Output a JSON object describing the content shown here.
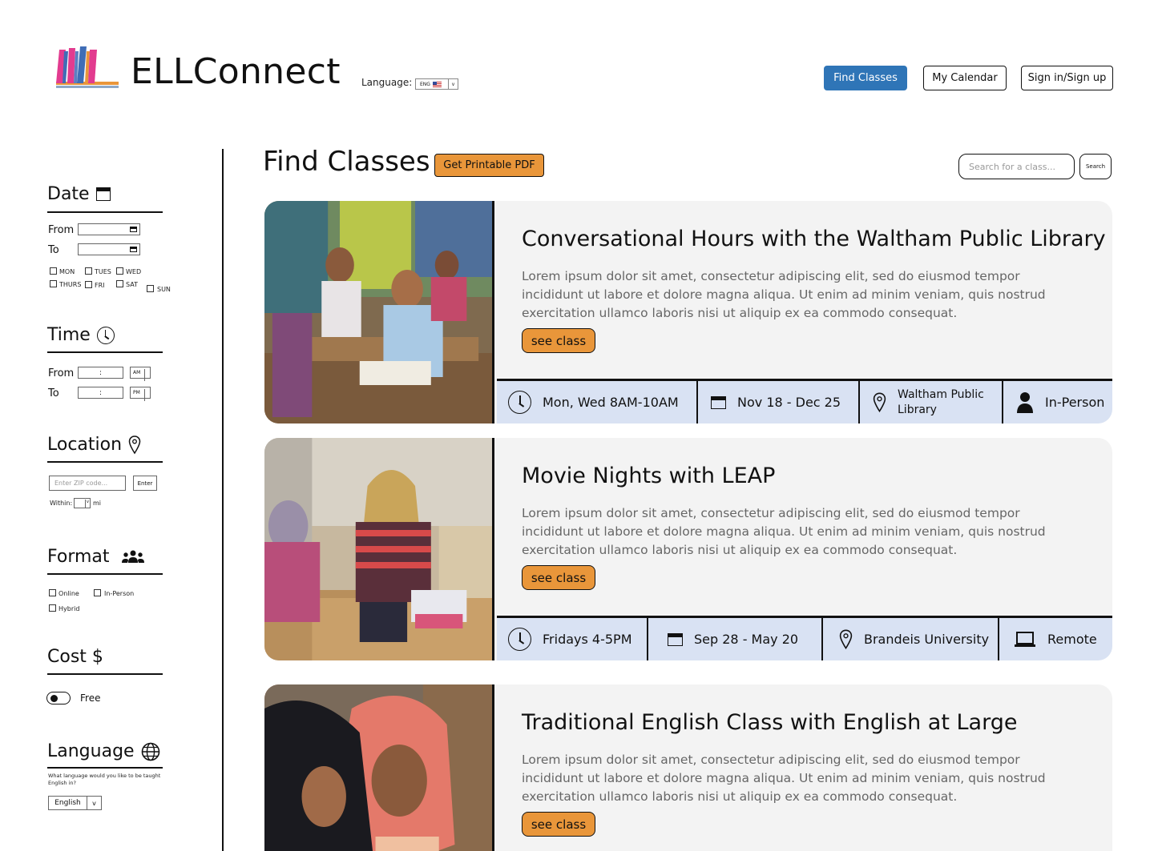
{
  "app": {
    "name": "ELLConnect",
    "language_label": "Language:",
    "language_code": "ENG"
  },
  "nav": {
    "find_classes": "Find Classes",
    "my_calendar": "My Calendar",
    "sign_in": "Sign in/Sign up"
  },
  "filters": {
    "date": {
      "title": "Date",
      "from": "From",
      "to": "To",
      "days": [
        "MON",
        "TUES",
        "WED",
        "THURS",
        "FRI",
        "SAT",
        "SUN"
      ]
    },
    "time": {
      "title": "Time",
      "from": "From",
      "to": "To",
      "placeholder": ":",
      "am": "AM",
      "pm": "PM"
    },
    "location": {
      "title": "Location",
      "zip_placeholder": "Enter ZIP code...",
      "enter": "Enter",
      "within": "Within:",
      "unit": "mi"
    },
    "format": {
      "title": "Format",
      "online": "Online",
      "in_person": "In-Person",
      "hybrid": "Hybrid"
    },
    "cost": {
      "title": "Cost $",
      "free": "Free"
    },
    "language": {
      "title": "Language",
      "question": "What language would you like to be taught English in?",
      "selected": "English",
      "arrow": "v"
    }
  },
  "main": {
    "title": "Find Classes",
    "pdf_button": "Get Printable PDF",
    "search_placeholder": "Search for a class...",
    "search_button": "Search",
    "see_class": "see class"
  },
  "classes": [
    {
      "title": "Conversational Hours with the Waltham Public Library",
      "description": "Lorem ipsum dolor sit amet, consectetur adipiscing elit, sed do eiusmod tempor incididunt ut labore et dolore magna aliqua. Ut enim ad minim veniam, quis nostrud exercitation ullamco laboris nisi ut aliquip ex ea commodo consequat.",
      "schedule": "Mon, Wed 8AM-10AM",
      "dates": "Nov 18 - Dec 25",
      "location": "Waltham Public Library",
      "format": "In-Person",
      "format_icon": "person-icon"
    },
    {
      "title": "Movie Nights with LEAP",
      "description": "Lorem ipsum dolor sit amet, consectetur adipiscing elit, sed do eiusmod tempor incididunt ut labore et dolore magna aliqua. Ut enim ad minim veniam, quis nostrud exercitation ullamco laboris nisi ut aliquip ex ea commodo consequat.",
      "schedule": "Fridays 4-5PM",
      "dates": "Sep 28 - May 20",
      "location": "Brandeis University",
      "format": "Remote",
      "format_icon": "laptop-icon"
    },
    {
      "title": "Traditional English Class with English at Large",
      "description": "Lorem ipsum dolor sit amet, consectetur adipiscing elit, sed do eiusmod tempor incididunt ut labore et dolore magna aliqua. Ut enim ad minim veniam, quis nostrud exercitation ullamco laboris nisi ut aliquip ex ea commodo consequat."
    }
  ],
  "colors": {
    "primary_blue": "#2f75b7",
    "accent_orange": "#e9963a",
    "meta_bar": "#d9e2f3",
    "card_bg": "#f3f3f3"
  }
}
